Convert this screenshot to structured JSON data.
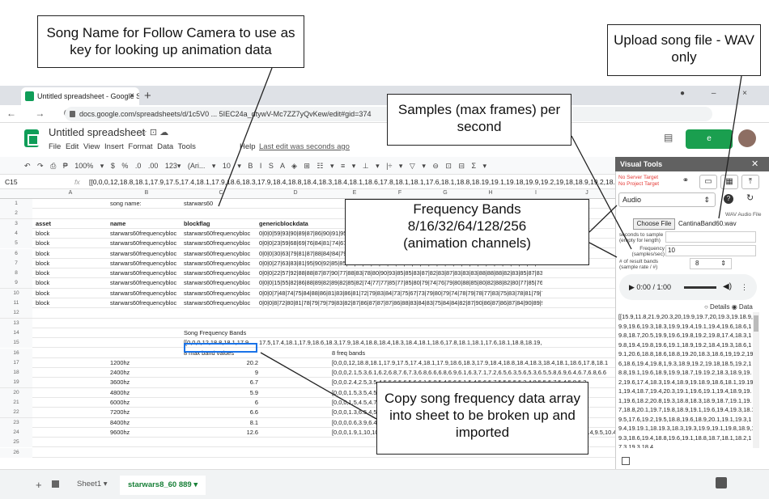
{
  "browser": {
    "tab_title": "Untitled spreadsheet - Google Sh",
    "tab_close": "×",
    "new_tab": "+",
    "url": "docs.google.com/spreadsheets/d/1c5V0 ... 5IEC24a_dtywV-Mc7ZZ7yQvKew/edit#gid=374",
    "nav": "← → C",
    "window_controls": "● –  ×"
  },
  "doc": {
    "title": "Untitled spreadsheet",
    "title_icons": "☆ ⊡ ☁",
    "menus": "File  Edit  View  Insert  Format  Data  Tools",
    "help": "Help",
    "last_edit": "Last edit was seconds ago",
    "share_label": "e"
  },
  "toolbar": {
    "items": "↶ ↷ ⎙ ₱  100% ▾  $  %  .0  .00  123▾  (Ari... ▾  10 ▾  B  I  S  A  ◈  ⊞  ☷ ▾  ≡ ▾  ⊥ ▾  |÷ ▾  ▽ ▾  ⊖  ⊡  ⊟  Σ ▾"
  },
  "formula_bar": {
    "cell_ref": "C15",
    "fx": "fx",
    "value": "[[0,0,0,12,18.8,18.1,17.9,17.5,17.4,18.1,17.9,18.6,18.3,17.9,18.4,18.8,18.4,18.3,18.4,18.1,18.6,17.8,18.1,18.1,17.6,18.1,18.8,18.19,19.1,19.18,19.9,19.2,19,18,18.9,19.2,18.5,18.6,18.8,1"
  },
  "grid": {
    "columns": [
      "A",
      "B",
      "C",
      "D",
      "E",
      "F",
      "G",
      "H",
      "I",
      "J"
    ],
    "rows": [
      {
        "n": "1",
        "a": "",
        "b": "song name:",
        "c": "starwars60",
        "d": "",
        "e": ""
      },
      {
        "n": "2",
        "a": "",
        "b": "",
        "c": "",
        "d": "",
        "e": ""
      },
      {
        "n": "3",
        "a": "asset",
        "b": "name",
        "c": "blockflag",
        "d": "genericblockdata",
        "e": ""
      },
      {
        "n": "4",
        "a": "block",
        "b": "starwars60frequencybloc",
        "c": "starwars60frequencybloc",
        "d": "0|0|0|59|93|90|89|87|86|90|8",
        "e": "91|95|92|95|95|96"
      },
      {
        "n": "5",
        "a": "block",
        "b": "starwars60frequencybloc",
        "c": "starwars60frequencybloc",
        "d": "0|0|0|23|59|68|69|76|84|81|7",
        "e": "74|67|74|67|69"
      },
      {
        "n": "6",
        "a": "block",
        "b": "starwars60frequencybloc",
        "c": "starwars60frequencybloc",
        "d": "0|0|0|30|63|79|81|87|88|84|9",
        "e": "84|79|80|83|77"
      },
      {
        "n": "7",
        "a": "block",
        "b": "starwars60frequencybloc",
        "c": "starwars60frequencybloc",
        "d": "0|0|0|27|63|83|81|95|90|92|85|85|90|86|78|83|90|86|86|85|86|83|81|87|90|86|92|86|86|85|82|81|86|90|82|81|86|85",
        "e": ""
      },
      {
        "n": "8",
        "a": "block",
        "b": "starwars60frequencybloc",
        "c": "starwars60frequencybloc",
        "d": "0|0|0|22|57|92|88|88|87|87|90|77|88|83|78|80|90|93|85|85|83|87|82|83|87|83|83|83|88|88|88|82|83|85|87|83|83|82",
        "e": ""
      },
      {
        "n": "9",
        "a": "block",
        "b": "starwars60frequencybloc",
        "c": "starwars60frequencybloc",
        "d": "0|0|0|15|55|82|86|88|89|82|89|82|85|82|74|77|77|85|77|85|80|79|74|76|79|80|88|85|80|82|88|82|80|77|85|76|77|77|77|80|76",
        "e": ""
      },
      {
        "n": "10",
        "a": "block",
        "b": "starwars60frequencybloc",
        "c": "starwars60frequencybloc",
        "d": "0|0|0|7|48|74|75|84|88|86|81|83|86|81|72|79|83|84|73|75|67|73|79|80|79|74|78|79|78|77|83|75|83|78|81|79|75|75|75",
        "e": ""
      },
      {
        "n": "11",
        "a": "block",
        "b": "starwars60frequencybloc",
        "c": "starwars60frequencybloc",
        "d": "0|0|0|8|72|80|81|78|79|79|79|83|82|87|86|87|87|87|86|88|83|84|83|75|84|84|82|87|90|86|87|86|87|84|90|89|90|87|92|89|87",
        "e": ""
      },
      {
        "n": "12",
        "a": "",
        "b": "",
        "c": "",
        "d": "",
        "e": ""
      },
      {
        "n": "13",
        "a": "",
        "b": "",
        "c": "",
        "d": "",
        "e": ""
      },
      {
        "n": "14",
        "a": "",
        "b": "",
        "c": "Song Frequency Bands",
        "d": "",
        "e": ""
      },
      {
        "n": "15",
        "a": "",
        "b": "",
        "c": "[[0,0,0,12,18.8,18.1,17.9",
        "d": "17.5,17.4,18.1,17.9,18.6,18.3,17.9,18.4,18.8,18.4,18.3,18.4,18.1,18.6,17.8,18.1,18.1,17.6,18.1,18.8,18.19,19.1,19.18,19.9,19.2,19",
        "e": ""
      },
      {
        "n": "16",
        "a": "",
        "b": "",
        "c": "8 max band values",
        "d": "",
        "e": "8 freq bands"
      },
      {
        "n": "17",
        "a": "",
        "b": "1200hz",
        "c": "20.2",
        "d": "",
        "e": "[0,0,0,12,18.8,18.1,17.9,17.5,17.4,18.1,17.9,18.6,18.3,17.9,18.4,18.8,18.4,18.3,18.4,18.1,18.6,17.8,18.1"
      },
      {
        "n": "18",
        "a": "",
        "b": "2400hz",
        "c": "9",
        "d": "",
        "e": "[0,0,0,2.1,5.3,6.1,6.2,6.8,7.6,7.3,6.8,6.6,6.8,6.9,6.1,6.3,7.1,7.2,6.5,6.3,5.6,5.3,6.5,5.8,6.9,6.4,6.7,6.8,6.6"
      },
      {
        "n": "19",
        "a": "",
        "b": "3600hz",
        "c": "6.7",
        "d": "",
        "e": "[0,0,0.2.4,2.5,3.5,4.5,5.6,5.6,5.6,6.1,5.8,5.4,5.6,5.1,5.4,5.6,5.7,5.5,5.5,5.2,4.8,5.5,5.7,5.4,5.8,5.3"
      },
      {
        "n": "20",
        "a": "",
        "b": "4800hz",
        "c": "5.9",
        "d": "",
        "e": "[0,0,0,1.5,3.5,4.5,4.7,4.5,4.6,4.7,4.5,4.5,4.6,4.6,4.6,4.4,4.5,4.5,4.3,4.3,4.4,4.5,4.1,4.5,1.5"
      },
      {
        "n": "21",
        "a": "",
        "b": "6000hz",
        "c": "6",
        "d": "",
        "e": "[0,0,0,1.5,4.5,4.7,5.6,5.8,5.6,5.3,5.4,5.6,5.4,5.2,5.2,5.5,5.4,5.3,5.6,5.3,5.5,5.5,5.3,5.5,5.3,5.5"
      },
      {
        "n": "22",
        "a": "",
        "b": "7200hz",
        "c": "6.6",
        "d": "",
        "e": "[0,0,0,1.3,6.5,4,5.6,5.8,6.3,5.8,5.9,6.2,5.6,5.6,5.8,6.4,5.8,5.6,5.3,5.6,5.8,5.6,5.8,5.5,6.2,5.8,5.6"
      },
      {
        "n": "23",
        "a": "",
        "b": "8400hz",
        "c": "8.1",
        "d": "",
        "e": "[0,0,0,0.6,3.9,6.4,6.8,7.2,6.9,6.3,6.6,6.2,6.1,6.4,6.7,6.9,6.6,6.3,6.2,6.4,6.5,6.8,6.4,6.1,6.4,6.6,6.3"
      },
      {
        "n": "24",
        "a": "",
        "b": "9600hz",
        "c": "12.6",
        "d": "",
        "e": "[0,0,0,1.9,1,10,10.1,10.4,10.5,10.6,10.3,10.6,10.2,10.5,10.4,10.3,10.5,10.2,10.4,9.9,10.4,10.2,10.4,9.5,10.4,9.5,1"
      },
      {
        "n": "25",
        "a": "",
        "b": "",
        "c": "",
        "d": "",
        "e": ""
      },
      {
        "n": "26",
        "a": "",
        "b": "",
        "c": "",
        "d": "",
        "e": ""
      }
    ]
  },
  "sheets": {
    "add": "+",
    "sheet1": "Sheet1 ▾",
    "sheet2": "starwars8_60 889 ▾"
  },
  "panel": {
    "title": "Visual Tools",
    "close": "✕",
    "server_target": "No Server Target",
    "project_target": "No Project Target",
    "type_select": "Audio",
    "wav_label": "WAV Audio File",
    "choose_file": "Choose File",
    "file_name": "CantinaBand60.wav",
    "seconds_label": "seconds to sample (empty for length)",
    "frequency_label": "Frequency (samples/sec)",
    "frequency_value": "10",
    "bands_label": "# of result bands (sample rate / #)",
    "bands_value": "8",
    "player_time": "▶   0:00 / 1:00",
    "details": "○ Details  ◉ Data",
    "data_text": "[[15.9,11.8,21.9,20.3,20,19.9,19.7,20,19.3,19.18.9,19.9,19.6,19.3,18.3,19.9,19.4,19.1,19.4,19.6,18.6,19.8,18.7,20.5,19.9,19.6,19.8,19.2,19.8,17.4,18.3,19.8,19.4,19.8,19.6,19.1,18.9,19.2,18.4,19.3,18.6,19.1,20.6,18.8,18.6,18.8,19.20,18.3,18.6,19,19.2,19.6,18.6,19.4,19.8,1,9.3,18.9,19.2,19.18,18.5,19.2,18.8,19.1,19.6,18.9,19.9,18.7,19.19.2,18.3,18.9,19.2,19.6,17.4,18.3,19.4,18.9,19.18.9,18.6,18.1,19.19.1,19.4,18.7,19.4,20.3,19.1,19.6,19.1,19.4,18.9,19.1,19.6,18.2,20.8,19.3,18.8,18.3,18.9,18.7,19.1,19.7,18.8,20.1,19.7,19.8,18.9,19.1,19.6,19.4,19.3,18.19.5,17.6,19.2,19.5,18.8,19.6,18.9,20.1,19.1,19.3,19.4,19.19.1,18.19.3,18.3,19.3,19.9,19.1,19.8,18.9,19.3,18.6,19.4,18.8,19.6,19.1,18.8,18.7,18.1,18.2,17.3,19.3,18.4,"
  },
  "callouts": {
    "song_name": "Song Name for Follow Camera to use as key for looking up animation data",
    "upload": "Upload song file - WAV only",
    "samples": "Samples (max frames) per second",
    "bands_line1": "Frequency Bands",
    "bands_line2": "8/16/32/64/128/256",
    "bands_line3": "(animation channels)",
    "copy": "Copy song frequency data array into sheet to be broken up and imported"
  }
}
